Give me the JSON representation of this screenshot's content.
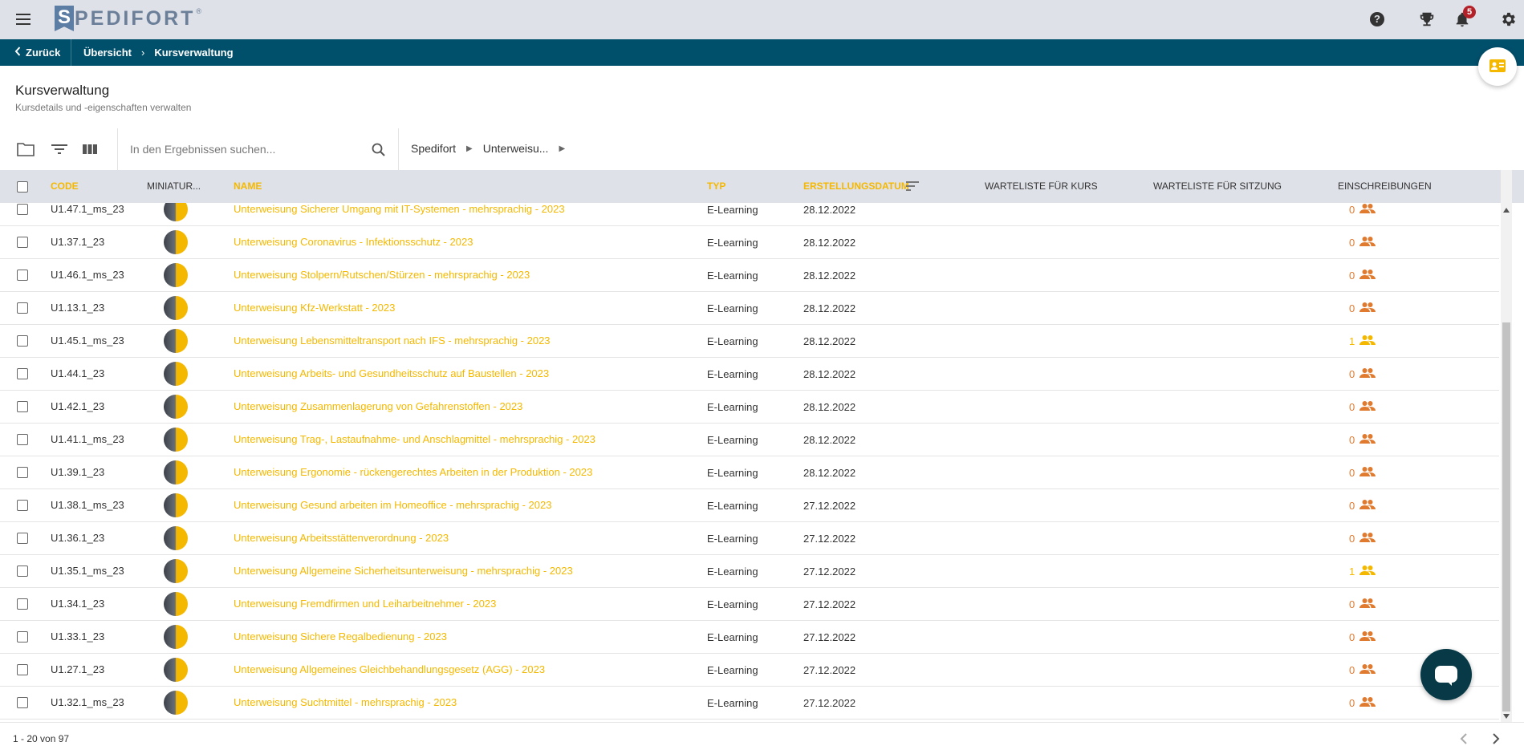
{
  "header": {
    "logo_letter": "S",
    "logo_text": "PEDIFORT",
    "logo_reg": "®",
    "help_glyph": "?",
    "notification_count": "5",
    "icons": [
      "menu-icon",
      "help-icon",
      "trophy-icon",
      "bell-icon",
      "gear-icon"
    ]
  },
  "breadcrumb": {
    "back_label": "Zurück",
    "items": [
      "Übersicht",
      "Kursverwaltung"
    ],
    "separator": "›"
  },
  "page": {
    "title": "Kursverwaltung",
    "subtitle": "Kursdetails und -eigenschaften verwalten"
  },
  "toolbar": {
    "search_placeholder": "In den Ergebnissen suchen...",
    "path": [
      "Spedifort",
      "Unterweisu..."
    ]
  },
  "table": {
    "columns": {
      "code": "CODE",
      "thumb": "MINIATUR...",
      "name": "NAME",
      "type": "TYP",
      "date": "ERSTELLUNGSDATUM",
      "waitlist_course": "WARTELISTE FÜR KURS",
      "waitlist_session": "WARTELISTE FÜR SITZUNG",
      "enrollments": "EINSCHREIBUNGEN"
    },
    "rows": [
      {
        "code": "U1.47.1_ms_23",
        "name": "Unterweisung Sicherer Umgang mit IT-Systemen - mehrsprachig - 2023",
        "type": "E-Learning",
        "date": "28.12.2022",
        "enrollments": "0"
      },
      {
        "code": "U1.37.1_23",
        "name": "Unterweisung Coronavirus - Infektionsschutz - 2023",
        "type": "E-Learning",
        "date": "28.12.2022",
        "enrollments": "0"
      },
      {
        "code": "U1.46.1_ms_23",
        "name": "Unterweisung Stolpern/Rutschen/Stürzen - mehrsprachig - 2023",
        "type": "E-Learning",
        "date": "28.12.2022",
        "enrollments": "0"
      },
      {
        "code": "U1.13.1_23",
        "name": "Unterweisung Kfz-Werkstatt - 2023",
        "type": "E-Learning",
        "date": "28.12.2022",
        "enrollments": "0"
      },
      {
        "code": "U1.45.1_ms_23",
        "name": "Unterweisung Lebensmitteltransport nach IFS - mehrsprachig - 2023",
        "type": "E-Learning",
        "date": "28.12.2022",
        "enrollments": "1"
      },
      {
        "code": "U1.44.1_23",
        "name": "Unterweisung Arbeits- und Gesundheitsschutz auf Baustellen - 2023",
        "type": "E-Learning",
        "date": "28.12.2022",
        "enrollments": "0"
      },
      {
        "code": "U1.42.1_23",
        "name": "Unterweisung Zusammenlagerung von Gefahrenstoffen - 2023",
        "type": "E-Learning",
        "date": "28.12.2022",
        "enrollments": "0"
      },
      {
        "code": "U1.41.1_ms_23",
        "name": "Unterweisung Trag-, Lastaufnahme- und Anschlagmittel - mehrsprachig - 2023",
        "type": "E-Learning",
        "date": "28.12.2022",
        "enrollments": "0"
      },
      {
        "code": "U1.39.1_23",
        "name": "Unterweisung Ergonomie - rückengerechtes Arbeiten in der Produktion - 2023",
        "type": "E-Learning",
        "date": "28.12.2022",
        "enrollments": "0"
      },
      {
        "code": "U1.38.1_ms_23",
        "name": "Unterweisung Gesund arbeiten im Homeoffice - mehrsprachig - 2023",
        "type": "E-Learning",
        "date": "27.12.2022",
        "enrollments": "0"
      },
      {
        "code": "U1.36.1_23",
        "name": "Unterweisung Arbeitsstättenverordnung - 2023",
        "type": "E-Learning",
        "date": "27.12.2022",
        "enrollments": "0"
      },
      {
        "code": "U1.35.1_ms_23",
        "name": "Unterweisung Allgemeine Sicherheitsunterweisung - mehrsprachig - 2023",
        "type": "E-Learning",
        "date": "27.12.2022",
        "enrollments": "1"
      },
      {
        "code": "U1.34.1_23",
        "name": "Unterweisung Fremdfirmen und Leiharbeitnehmer - 2023",
        "type": "E-Learning",
        "date": "27.12.2022",
        "enrollments": "0"
      },
      {
        "code": "U1.33.1_23",
        "name": "Unterweisung Sichere Regalbedienung - 2023",
        "type": "E-Learning",
        "date": "27.12.2022",
        "enrollments": "0"
      },
      {
        "code": "U1.27.1_23",
        "name": "Unterweisung Allgemeines Gleichbehandlungsgesetz (AGG) - 2023",
        "type": "E-Learning",
        "date": "27.12.2022",
        "enrollments": "0"
      },
      {
        "code": "U1.32.1_ms_23",
        "name": "Unterweisung Suchtmittel - mehrsprachig - 2023",
        "type": "E-Learning",
        "date": "27.12.2022",
        "enrollments": "0"
      }
    ]
  },
  "pagination": {
    "label": "1 - 20 von 97"
  },
  "colors": {
    "accent": "#f5b800",
    "nav_bar": "#004f6b",
    "header_bg": "#dfe1e8",
    "enrollment_zero": "#e07a2e",
    "chat_fab": "#073a46"
  }
}
